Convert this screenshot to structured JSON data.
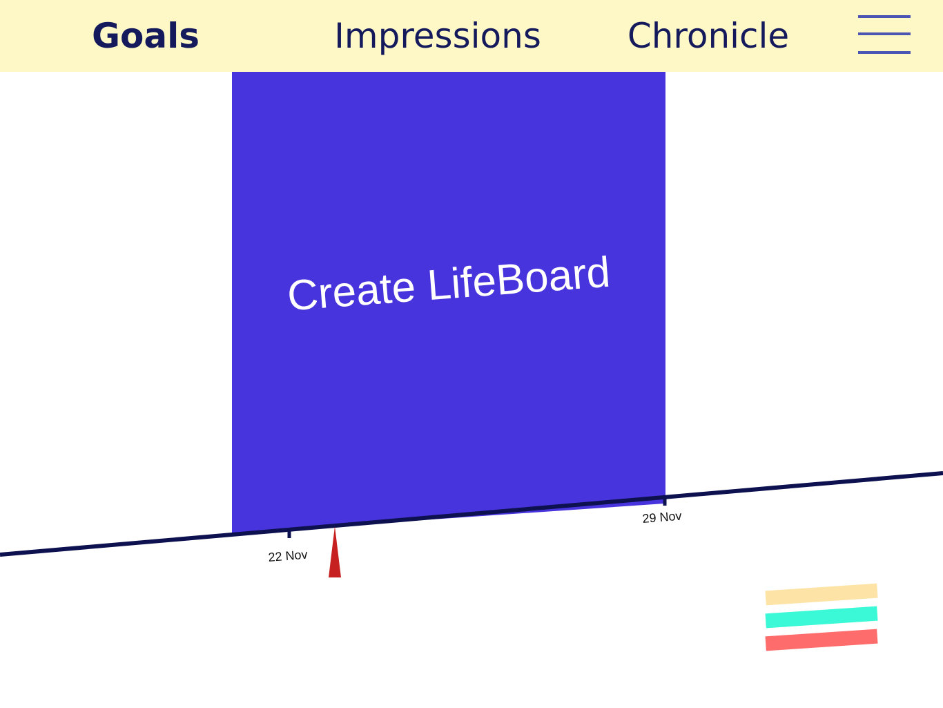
{
  "nav": {
    "tabs": [
      {
        "label": "Goals",
        "active": true
      },
      {
        "label": "Impressions",
        "active": false
      },
      {
        "label": "Chronicle",
        "active": false
      }
    ],
    "menu_icon": "hamburger-menu-icon"
  },
  "goal": {
    "title": "Create LifeBoard",
    "color": "#4834dc"
  },
  "timeline": {
    "ticks": [
      "22 Nov",
      "29 Nov"
    ],
    "line_color": "#0d1150",
    "current_marker_color": "#c62020"
  },
  "legend": {
    "colors": [
      "#fde4a6",
      "#3bf8d6",
      "#fe6c6c"
    ]
  },
  "colors": {
    "nav_background": "#fdf8c6",
    "nav_text": "#141a5c",
    "menu_icon": "#4b55b4"
  }
}
